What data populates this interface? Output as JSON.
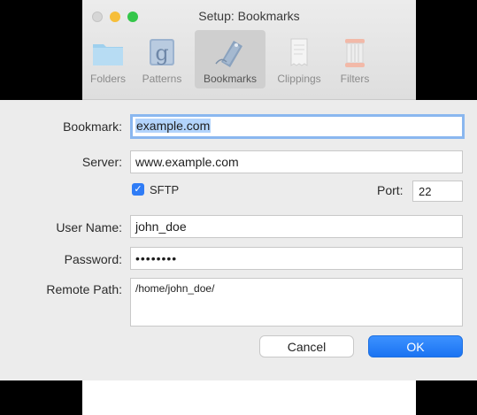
{
  "window": {
    "title": "Setup: Bookmarks"
  },
  "toolbar": {
    "items": [
      {
        "label": "Folders",
        "icon": "folder-icon",
        "selected": false
      },
      {
        "label": "Patterns",
        "icon": "patterns-icon",
        "selected": false
      },
      {
        "label": "Bookmarks",
        "icon": "bookmark-tag-icon",
        "selected": true
      },
      {
        "label": "Clippings",
        "icon": "clippings-icon",
        "selected": false
      },
      {
        "label": "Filters",
        "icon": "filter-spool-icon",
        "selected": false
      }
    ]
  },
  "form": {
    "bookmark_label": "Bookmark:",
    "bookmark_value": "example.com",
    "server_label": "Server:",
    "server_value": "www.example.com",
    "sftp_label": "SFTP",
    "sftp_checked": true,
    "port_label": "Port:",
    "port_value": "22",
    "username_label": "User Name:",
    "username_value": "john_doe",
    "password_label": "Password:",
    "password_value": "••••••••",
    "remote_path_label": "Remote Path:",
    "remote_path_value": "/home/john_doe/"
  },
  "buttons": {
    "cancel": "Cancel",
    "ok": "OK"
  },
  "colors": {
    "accent": "#1a73f2",
    "focus_ring": "#8ab7ef",
    "selection": "#b3d4fc"
  }
}
